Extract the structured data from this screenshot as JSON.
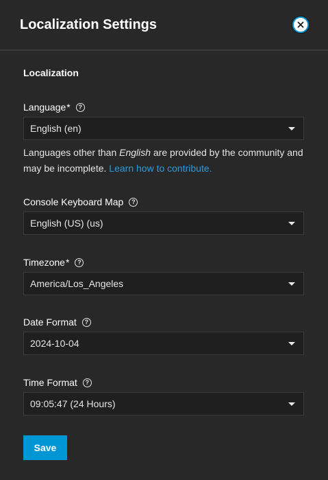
{
  "header": {
    "title": "Localization Settings"
  },
  "section": {
    "title": "Localization"
  },
  "fields": {
    "language": {
      "label": "Language",
      "required": "*",
      "value": "English (en)"
    },
    "keyboard": {
      "label": "Console Keyboard Map",
      "value": "English (US) (us)"
    },
    "timezone": {
      "label": "Timezone",
      "required": "*",
      "value": "America/Los_Angeles"
    },
    "date_format": {
      "label": "Date Format",
      "value": "2024-10-04"
    },
    "time_format": {
      "label": "Time Format",
      "value": "09:05:47 (24 Hours)"
    }
  },
  "hint": {
    "text_before": "Languages other than ",
    "emphasis": "English",
    "text_after": " are provided by the community and may be incomplete. ",
    "link": "Learn how to contribute."
  },
  "help_glyph": "?",
  "save_label": "Save",
  "colors": {
    "accent": "#0095d5",
    "link": "#2f9ad8",
    "background": "#282828",
    "input_bg": "#1f1f1f"
  }
}
